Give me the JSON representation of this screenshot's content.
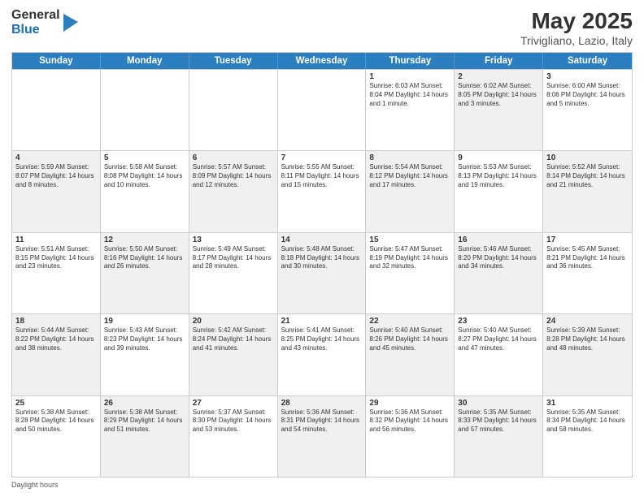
{
  "logo": {
    "general": "General",
    "blue": "Blue"
  },
  "title": "May 2025",
  "subtitle": "Trivigliano, Lazio, Italy",
  "days_of_week": [
    "Sunday",
    "Monday",
    "Tuesday",
    "Wednesday",
    "Thursday",
    "Friday",
    "Saturday"
  ],
  "footer": "Daylight hours",
  "weeks": [
    [
      {
        "day": "",
        "info": "",
        "shaded": false,
        "empty": true
      },
      {
        "day": "",
        "info": "",
        "shaded": false,
        "empty": true
      },
      {
        "day": "",
        "info": "",
        "shaded": false,
        "empty": true
      },
      {
        "day": "",
        "info": "",
        "shaded": false,
        "empty": true
      },
      {
        "day": "1",
        "info": "Sunrise: 6:03 AM\nSunset: 8:04 PM\nDaylight: 14 hours and 1 minute.",
        "shaded": false,
        "empty": false
      },
      {
        "day": "2",
        "info": "Sunrise: 6:02 AM\nSunset: 8:05 PM\nDaylight: 14 hours and 3 minutes.",
        "shaded": true,
        "empty": false
      },
      {
        "day": "3",
        "info": "Sunrise: 6:00 AM\nSunset: 8:06 PM\nDaylight: 14 hours and 5 minutes.",
        "shaded": false,
        "empty": false
      }
    ],
    [
      {
        "day": "4",
        "info": "Sunrise: 5:59 AM\nSunset: 8:07 PM\nDaylight: 14 hours and 8 minutes.",
        "shaded": true,
        "empty": false
      },
      {
        "day": "5",
        "info": "Sunrise: 5:58 AM\nSunset: 8:08 PM\nDaylight: 14 hours and 10 minutes.",
        "shaded": false,
        "empty": false
      },
      {
        "day": "6",
        "info": "Sunrise: 5:57 AM\nSunset: 8:09 PM\nDaylight: 14 hours and 12 minutes.",
        "shaded": true,
        "empty": false
      },
      {
        "day": "7",
        "info": "Sunrise: 5:55 AM\nSunset: 8:11 PM\nDaylight: 14 hours and 15 minutes.",
        "shaded": false,
        "empty": false
      },
      {
        "day": "8",
        "info": "Sunrise: 5:54 AM\nSunset: 8:12 PM\nDaylight: 14 hours and 17 minutes.",
        "shaded": true,
        "empty": false
      },
      {
        "day": "9",
        "info": "Sunrise: 5:53 AM\nSunset: 8:13 PM\nDaylight: 14 hours and 19 minutes.",
        "shaded": false,
        "empty": false
      },
      {
        "day": "10",
        "info": "Sunrise: 5:52 AM\nSunset: 8:14 PM\nDaylight: 14 hours and 21 minutes.",
        "shaded": true,
        "empty": false
      }
    ],
    [
      {
        "day": "11",
        "info": "Sunrise: 5:51 AM\nSunset: 8:15 PM\nDaylight: 14 hours and 23 minutes.",
        "shaded": false,
        "empty": false
      },
      {
        "day": "12",
        "info": "Sunrise: 5:50 AM\nSunset: 8:16 PM\nDaylight: 14 hours and 26 minutes.",
        "shaded": true,
        "empty": false
      },
      {
        "day": "13",
        "info": "Sunrise: 5:49 AM\nSunset: 8:17 PM\nDaylight: 14 hours and 28 minutes.",
        "shaded": false,
        "empty": false
      },
      {
        "day": "14",
        "info": "Sunrise: 5:48 AM\nSunset: 8:18 PM\nDaylight: 14 hours and 30 minutes.",
        "shaded": true,
        "empty": false
      },
      {
        "day": "15",
        "info": "Sunrise: 5:47 AM\nSunset: 8:19 PM\nDaylight: 14 hours and 32 minutes.",
        "shaded": false,
        "empty": false
      },
      {
        "day": "16",
        "info": "Sunrise: 5:46 AM\nSunset: 8:20 PM\nDaylight: 14 hours and 34 minutes.",
        "shaded": true,
        "empty": false
      },
      {
        "day": "17",
        "info": "Sunrise: 5:45 AM\nSunset: 8:21 PM\nDaylight: 14 hours and 36 minutes.",
        "shaded": false,
        "empty": false
      }
    ],
    [
      {
        "day": "18",
        "info": "Sunrise: 5:44 AM\nSunset: 8:22 PM\nDaylight: 14 hours and 38 minutes.",
        "shaded": true,
        "empty": false
      },
      {
        "day": "19",
        "info": "Sunrise: 5:43 AM\nSunset: 8:23 PM\nDaylight: 14 hours and 39 minutes.",
        "shaded": false,
        "empty": false
      },
      {
        "day": "20",
        "info": "Sunrise: 5:42 AM\nSunset: 8:24 PM\nDaylight: 14 hours and 41 minutes.",
        "shaded": true,
        "empty": false
      },
      {
        "day": "21",
        "info": "Sunrise: 5:41 AM\nSunset: 8:25 PM\nDaylight: 14 hours and 43 minutes.",
        "shaded": false,
        "empty": false
      },
      {
        "day": "22",
        "info": "Sunrise: 5:40 AM\nSunset: 8:26 PM\nDaylight: 14 hours and 45 minutes.",
        "shaded": true,
        "empty": false
      },
      {
        "day": "23",
        "info": "Sunrise: 5:40 AM\nSunset: 8:27 PM\nDaylight: 14 hours and 47 minutes.",
        "shaded": false,
        "empty": false
      },
      {
        "day": "24",
        "info": "Sunrise: 5:39 AM\nSunset: 8:28 PM\nDaylight: 14 hours and 48 minutes.",
        "shaded": true,
        "empty": false
      }
    ],
    [
      {
        "day": "25",
        "info": "Sunrise: 5:38 AM\nSunset: 8:28 PM\nDaylight: 14 hours and 50 minutes.",
        "shaded": false,
        "empty": false
      },
      {
        "day": "26",
        "info": "Sunrise: 5:38 AM\nSunset: 8:29 PM\nDaylight: 14 hours and 51 minutes.",
        "shaded": true,
        "empty": false
      },
      {
        "day": "27",
        "info": "Sunrise: 5:37 AM\nSunset: 8:30 PM\nDaylight: 14 hours and 53 minutes.",
        "shaded": false,
        "empty": false
      },
      {
        "day": "28",
        "info": "Sunrise: 5:36 AM\nSunset: 8:31 PM\nDaylight: 14 hours and 54 minutes.",
        "shaded": true,
        "empty": false
      },
      {
        "day": "29",
        "info": "Sunrise: 5:36 AM\nSunset: 8:32 PM\nDaylight: 14 hours and 56 minutes.",
        "shaded": false,
        "empty": false
      },
      {
        "day": "30",
        "info": "Sunrise: 5:35 AM\nSunset: 8:33 PM\nDaylight: 14 hours and 57 minutes.",
        "shaded": true,
        "empty": false
      },
      {
        "day": "31",
        "info": "Sunrise: 5:35 AM\nSunset: 8:34 PM\nDaylight: 14 hours and 58 minutes.",
        "shaded": false,
        "empty": false
      }
    ]
  ]
}
